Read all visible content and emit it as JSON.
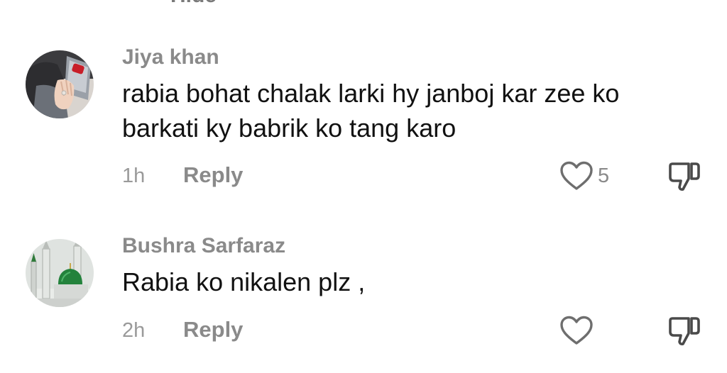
{
  "hide_link": "Hide",
  "comments": [
    {
      "author": "Jiya khan",
      "text": "rabia bohat chalak larki hy janboj kar zee ko barkati ky babrik ko tang karo",
      "time": "1h",
      "reply_label": "Reply",
      "like_count": "5",
      "avatar_icon": "profile-photo-hand-icon"
    },
    {
      "author": "Bushra Sarfaraz",
      "text": "Rabia ko nikalen plz ,",
      "time": "2h",
      "reply_label": "Reply",
      "like_count": "",
      "avatar_icon": "mosque-green-dome-icon"
    }
  ],
  "colors": {
    "background": "#ffffff",
    "primary_text": "#111111",
    "secondary_text": "#8a8a8a"
  }
}
